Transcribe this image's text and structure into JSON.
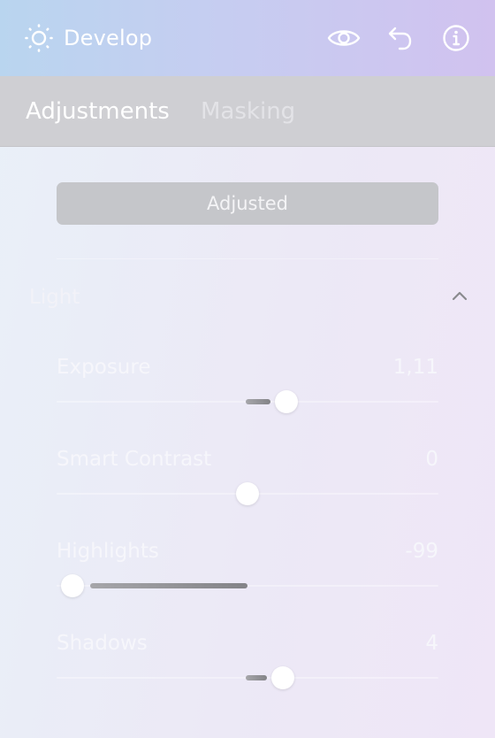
{
  "header": {
    "title": "Develop",
    "icons": [
      "sun-icon",
      "eye-icon",
      "undo-icon",
      "info-icon"
    ]
  },
  "tabs": [
    {
      "label": "Adjustments",
      "active": true
    },
    {
      "label": "Masking",
      "active": false
    }
  ],
  "adjusted_button": {
    "label": "Adjusted"
  },
  "section": {
    "title": "Light",
    "expanded": true
  },
  "sliders": [
    {
      "label": "Exposure",
      "value": "1,11",
      "numeric": 1.11,
      "min": -5,
      "max": 5
    },
    {
      "label": "Smart Contrast",
      "value": "0",
      "numeric": 0,
      "min": -100,
      "max": 100
    },
    {
      "label": "Highlights",
      "value": "-99",
      "numeric": -99,
      "min": -100,
      "max": 100
    },
    {
      "label": "Shadows",
      "value": "4",
      "numeric": 4,
      "min": -20,
      "max": 20
    }
  ],
  "colors": {
    "header_gradient_start": "#b9d5ef",
    "header_gradient_end": "#d1c2ef",
    "tabs_background": "#cfcfd3",
    "button_background": "#c5c6ca"
  }
}
